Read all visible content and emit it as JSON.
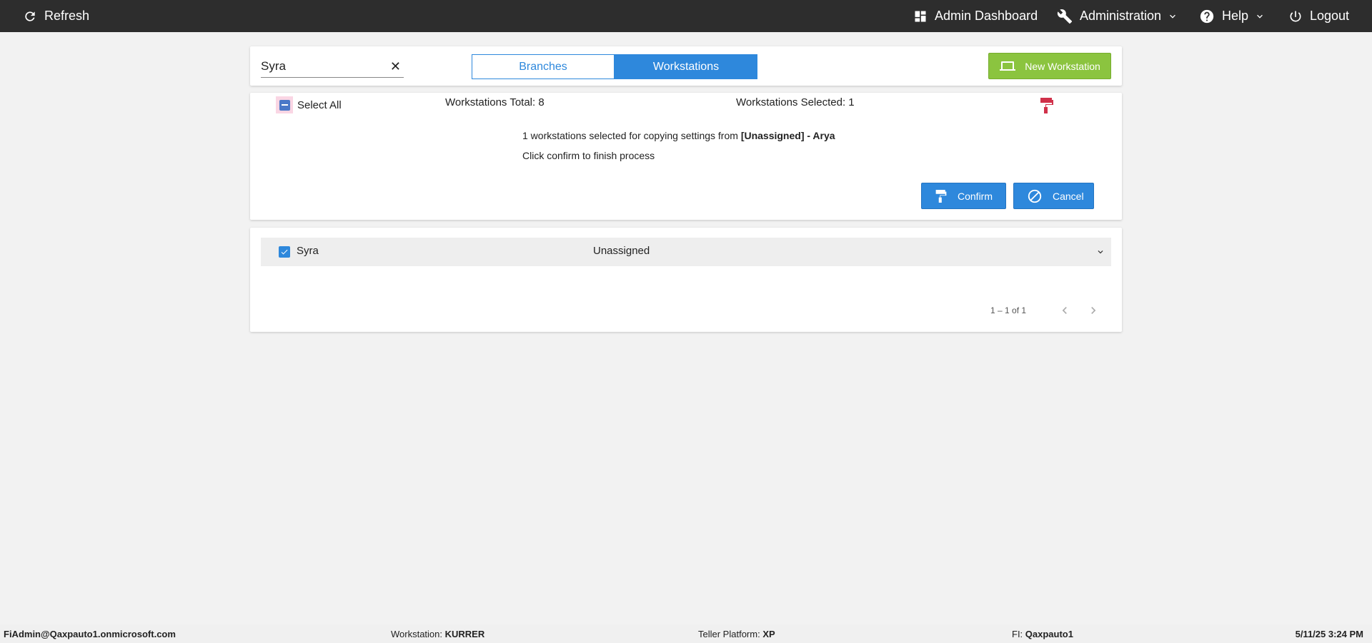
{
  "topbar": {
    "refresh_label": "Refresh",
    "admin_dashboard_label": "Admin Dashboard",
    "administration_label": "Administration",
    "help_label": "Help",
    "logout_label": "Logout"
  },
  "toolbar": {
    "search_value": "Syra",
    "clear_symbol": "✕",
    "tabs": [
      {
        "label": "Branches",
        "active": false
      },
      {
        "label": "Workstations",
        "active": true
      }
    ],
    "new_workstation_label": "New Workstation"
  },
  "copy_panel": {
    "select_all_label": "Select All",
    "workstations_total": "Workstations Total: 8",
    "workstations_selected": "Workstations Selected: 1",
    "message_prefix": "1 workstations selected for copying settings from ",
    "message_source": "[Unassigned] - Arya",
    "message_line2": "Click confirm to finish process",
    "confirm_label": "Confirm",
    "cancel_label": "Cancel"
  },
  "list": {
    "rows": [
      {
        "name": "Syra",
        "branch": "Unassigned",
        "checked": true
      }
    ],
    "pager_text": "1 – 1 of 1"
  },
  "statusbar": {
    "user": "FiAdmin@Qaxpauto1.onmicrosoft.com",
    "workstation_label": "Workstation: ",
    "workstation_value": "KURRER",
    "platform_label": "Teller Platform: ",
    "platform_value": "XP",
    "fi_label": "FI: ",
    "fi_value": "Qaxpauto1",
    "datetime": "5/11/25 3:24 PM"
  },
  "colors": {
    "topbar_bg": "#2d2d2d",
    "primary_blue": "#2e88dc",
    "green": "#8bc43f",
    "paint_icon_red": "#d0314a"
  }
}
